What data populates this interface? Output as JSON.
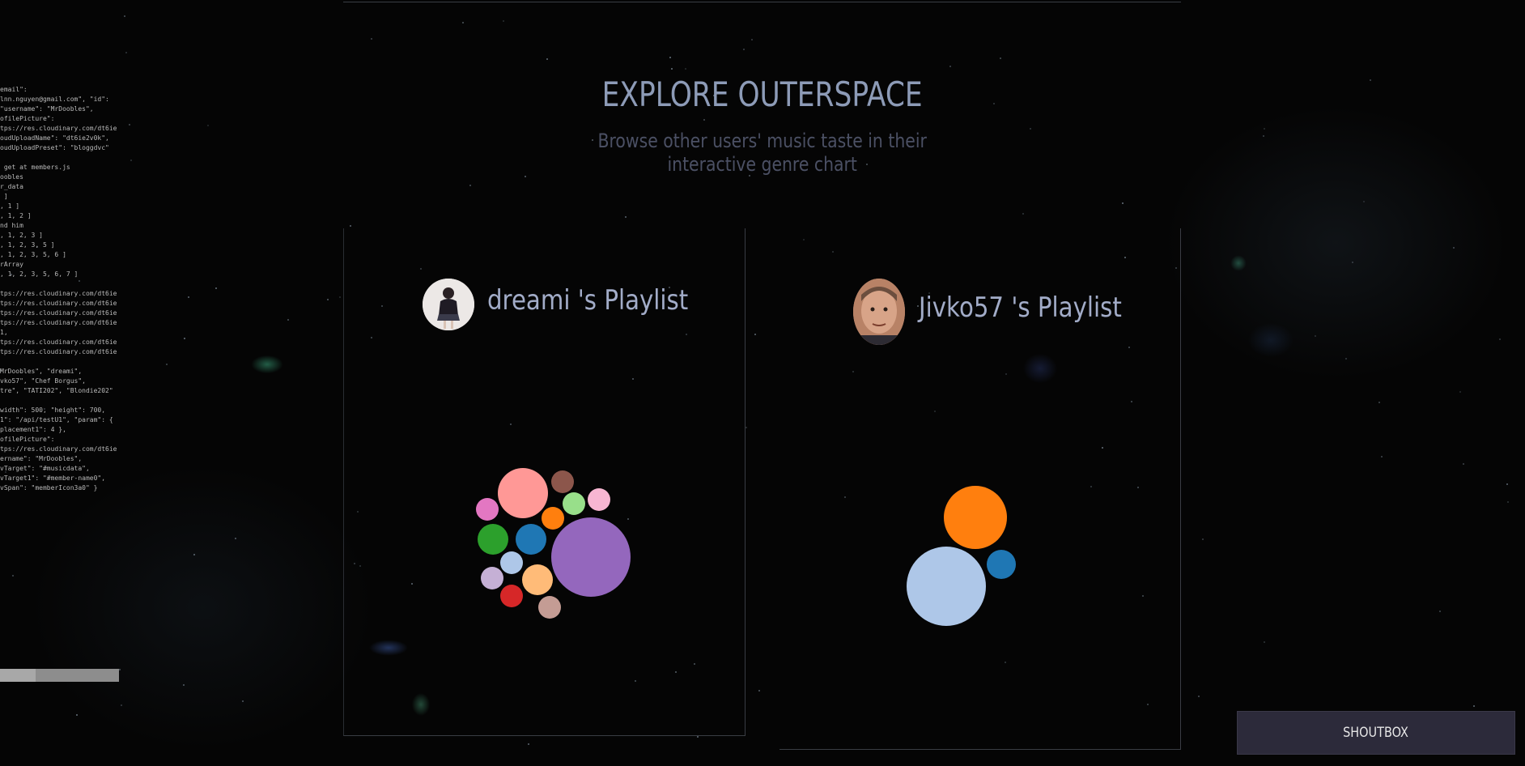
{
  "header": {
    "title": "EXPLORE OUTERSPACE",
    "subtitle_line1": "Browse other users' music taste in their",
    "subtitle_line2": "interactive genre chart"
  },
  "code_panel": {
    "lines": [
      "email\":",
      "lnn.nguyen@gmail.com\", \"id\":",
      "\"username\": \"MrDoobles\",",
      "ofilePicture\":",
      "tps://res.cloudinary.com/dt6ie",
      "oudUploadName\": \"dt6ie2v0k\",",
      "oudUploadPreset\": \"bloggdvc\"",
      "",
      " get at members.js",
      "oobles",
      "r_data",
      " ]",
      ", 1 ]",
      ", 1, 2 ]",
      "nd him",
      ", 1, 2, 3 ]",
      ", 1, 2, 3, 5 ]",
      ", 1, 2, 3, 5, 6 ]",
      "rArray",
      ", 1, 2, 3, 5, 6, 7 ]",
      "",
      "tps://res.cloudinary.com/dt6ie",
      "tps://res.cloudinary.com/dt6ie",
      "tps://res.cloudinary.com/dt6ie",
      "tps://res.cloudinary.com/dt6ie",
      "1,",
      "tps://res.cloudinary.com/dt6ie",
      "tps://res.cloudinary.com/dt6ie",
      "",
      "MrDoobles\", \"dreami\",",
      "vko57\", \"Chef Borgus\",",
      "tre\", \"TATI202\", \"Blondie202\"",
      "",
      "width\": 500, \"height\": 700,",
      "1\": \"/api/testU1\", \"param\": {",
      "placement1\": 4 },",
      "ofilePicture\":",
      "tps://res.cloudinary.com/dt6ie",
      "ername\": \"MrDoobles\",",
      "vTarget\": \"#musicdata\",",
      "vTarget1\": \"#member-name0\",",
      "vSpan\": \"memberIcon3a0\" }"
    ]
  },
  "playlists": [
    {
      "username": "dreami",
      "title": "dreami 's Playlist",
      "bubble_colors": [
        "#ff9896",
        "#8c564b",
        "#98df8a",
        "#f7b6d2",
        "#e377c2",
        "#ff7f0e",
        "#2ca02c",
        "#1f77b4",
        "#9467bd",
        "#aec7e8",
        "#c5b0d5",
        "#ffbb78",
        "#d62728",
        "#c49c94"
      ]
    },
    {
      "username": "Jivko57",
      "title": "Jivko57 's Playlist",
      "bubble_colors": [
        "#ff7f0e",
        "#1f77b4",
        "#aec7e8"
      ]
    }
  ],
  "shoutbox": {
    "label": "SHOUTBOX"
  }
}
